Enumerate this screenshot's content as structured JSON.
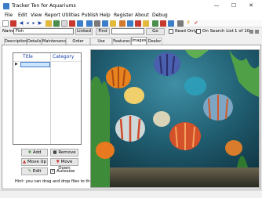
{
  "window": {
    "title": "Tracker Ten for Aquariums",
    "minimize": "—",
    "maximize": "☐",
    "close": "✕"
  },
  "menu": [
    "File",
    "Edit",
    "View",
    "Report",
    "Utilities",
    "Publish",
    "Help",
    "Register",
    "About",
    "Debug"
  ],
  "namebar": {
    "name_label": "Name",
    "name_value": "Fish",
    "linked_button": "Linked",
    "find_button": "Find",
    "go_button": "Go",
    "read_only_label": "Read Only",
    "on_search_list_label": "On Search List",
    "record_position": "1 of 10"
  },
  "tabs": [
    "Description",
    "Details",
    "Maintenance",
    "Order History",
    "Use History",
    "Features",
    "Images",
    "Dealer"
  ],
  "images_tab": {
    "columns": [
      "Title",
      "Category"
    ],
    "add_button": "Add",
    "remove_button": "Remove",
    "move_up_button": "Move Up",
    "move_down_button": "Move Down",
    "edit_button": "Edit",
    "autosize_label": "Autosize",
    "autosize_checked": true,
    "hint": "Hint: you can drag and drop files to the list."
  },
  "colors": {
    "accent": "#1a3fa8",
    "selection_row": "#cce4ff"
  }
}
